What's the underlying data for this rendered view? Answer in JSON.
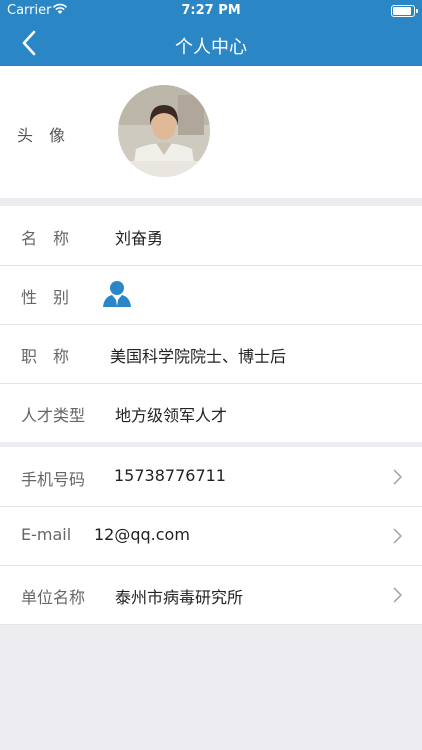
{
  "status": {
    "carrier": "Carrier",
    "time": "7:27 PM"
  },
  "nav": {
    "title": "个人中心"
  },
  "avatar": {
    "label": "头　像"
  },
  "info": {
    "name_label": "名　称",
    "name_value": "刘奋勇",
    "gender_label": "性　别",
    "title_label": "职　称",
    "title_value": "美国科学院院士、博士后",
    "talent_label": "人才类型",
    "talent_value": "地方级领军人才"
  },
  "contact": {
    "phone_label": "手机号码",
    "phone_value": "15738776711",
    "email_label": "E-mail",
    "email_value": "12@qq.com",
    "org_label": "单位名称",
    "org_value": "泰州市病毒研究所"
  }
}
